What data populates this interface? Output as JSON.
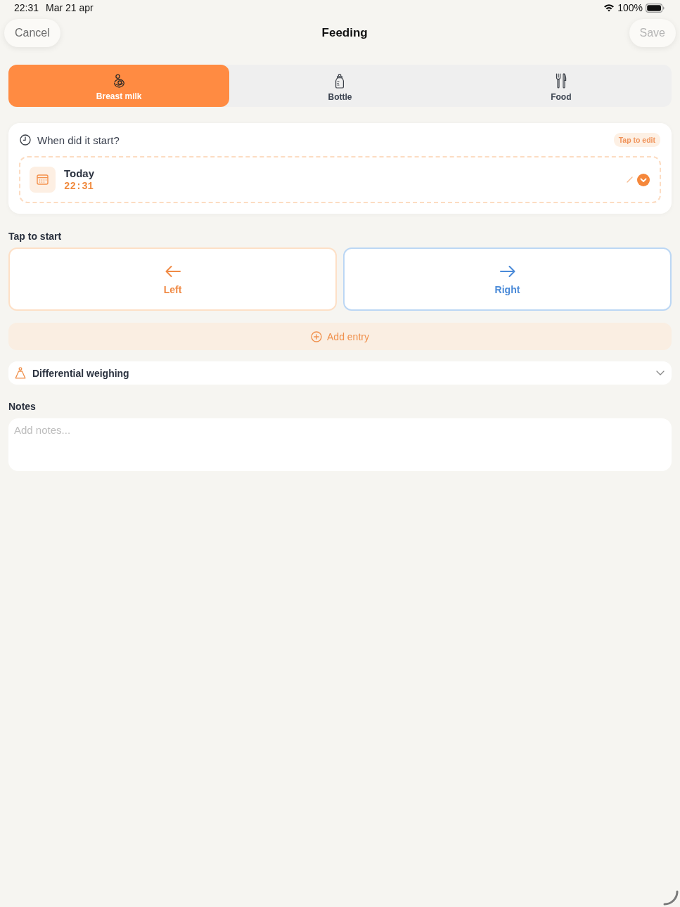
{
  "status_bar": {
    "time": "22:31",
    "date": "Mar 21 apr",
    "battery": "100%"
  },
  "nav": {
    "cancel": "Cancel",
    "title": "Feeding",
    "save": "Save",
    "save_disabled": true
  },
  "feed_types": [
    {
      "label": "Breast milk",
      "kind": "breast",
      "selected": true
    },
    {
      "label": "Bottle",
      "kind": "bottle",
      "selected": false
    },
    {
      "label": "Food",
      "kind": "food",
      "selected": false
    }
  ],
  "start_time": {
    "question": "When did it start?",
    "badge": "Tap to edit",
    "day": "Today",
    "time": "22:31"
  },
  "sides": {
    "heading": "Tap to start",
    "buttons": [
      {
        "label": "Left",
        "kind": "left"
      },
      {
        "label": "Right",
        "kind": "right"
      }
    ]
  },
  "add_entry": {
    "label": "Add entry"
  },
  "weighing": {
    "label": "Differential weighing",
    "expanded": false
  },
  "notes": {
    "label": "Notes",
    "placeholder": "Add notes..."
  }
}
